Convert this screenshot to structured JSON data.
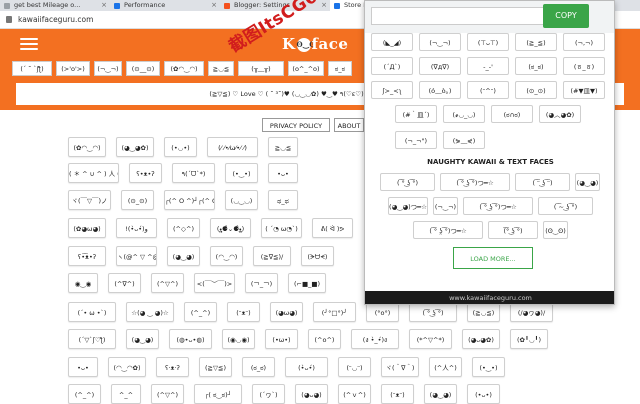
{
  "browser": {
    "tabs": [
      {
        "label": "get best Mileage o...",
        "icon": "page-icon"
      },
      {
        "label": "Performance",
        "icon": "page-icon"
      },
      {
        "label": "Blogger: Settings",
        "icon": "blogger-icon"
      },
      {
        "label": "Store L...",
        "icon": "store-icon"
      }
    ],
    "url": "kawaiifaceguru.com"
  },
  "site": {
    "logo_left": "K",
    "logo_face": "ʘ‿ʘ",
    "logo_right": "face",
    "banner_text": "(≧▽≦) ♡ Love ♡ ( ˘ ³˘)♥ (◡‿◡✿) ♥‿♥ ٩(♡ε♡)۶ (灬♥ω♥灬) ( ˘ ³˘)♥"
  },
  "watermark": "截图ItsCG6",
  "face_bar": [
    "(´ ˘ `ʃƪ)",
    "(>'o'>)",
    "(¬‿¬)",
    "(⊙__⊙)",
    "(✿◠‿◠)",
    "≧◡≦",
    "(╥﹏╥)",
    "(o^_^o)",
    "ಠ_ಠ",
    "ᕙ(⇀‸↼)ᕗ",
    "(◕‿◕✿)",
    "(ᵔᴥᵔ)",
    "<"
  ],
  "links": {
    "privacy": "PRIVACY POLICY",
    "about": "ABOUT"
  },
  "grid": [
    [
      "(✿◠‿◠)",
      "(◕‿◕✿)",
      "(•◡•)",
      "(⁄ ⁄•⁄ω⁄•⁄ ⁄)",
      "≧◡≦"
    ],
    [
      "( ＊ ^ ∪ ^ ) 人 (≧∀≦*)",
      "ʕ•ᴥ•ʔ",
      "٩(ˊᗜˋ*)",
      "(•‿•)",
      "•ᴗ•"
    ],
    [
      "ヾ(￣▽￣)ノ",
      "(⊙_⊙)",
      "┌(^ O ^)┘┌(^ O ^)┘",
      "(◡‿◡)",
      "ಥ_ಥ"
    ],
    [
      "(✿◕ω◕)",
      "!(•̀ᴗ•́)و",
      "(^◇^)",
      "(•ૢ⚈͒⌄⚈͒•ૢ)",
      "( ´◔ ω◔`)",
      "ᕕ( ᐛ )ᕗ"
    ],
    [
      "ʕ•͡ᴥ•ʔ",
      "ヽ(@^ ▽ ^@)ﾉ",
      "(◕‿◕)",
      "(◠‿◠)",
      "(≧∇≦)/",
      "(ᗒᗨᗕ)"
    ],
    [
      "◉‿◉",
      "(^∇^)",
      "(^▽^)",
      "<(￣︶￣)>",
      "(￢_￢)",
      "(⌐■_■)"
    ],
    [
      "(´• ω •`)",
      "☆(◕ ‿ ◕)☆",
      "(^_^)",
      "(ᵔᴥᵔ)",
      "(◕ω◕)",
      "(╯°□°)╯",
      "(°o°)",
      "( ͡° ͜ʖ ͡°)",
      "(≧◡≦)",
      "(/◕ヮ◕)/"
    ],
    [
      "(´▽`ʃ♡ƪ)",
      "(◕‿◕)",
      "(◍•ᴗ•◍)",
      "(◉◡◉)",
      "(•ω•)",
      "(^o^)",
      "(ง •̀_•́)ง",
      "(*^▽^*)",
      "(◕ᴗ◕✿)",
      "(✿╹◡╹)"
    ],
    [
      "•ᴗ•",
      "(◠‿◠✿)",
      "ʕ·ᴥ·ʔ",
      "(≧▽≦)",
      "(ಠ_ಠ)",
      "(•̀ᴗ•́)",
      "(ᵔ◡ᵔ)",
      "ヾ(＾∇＾)",
      "(^人^)",
      "(•‿•)"
    ],
    [
      "(^_^)",
      "^_^",
      "(^▽^)",
      "┌( ಠ‿ಠ)┘",
      "(´ヮ`)",
      "(◕ᴗ◕)",
      "(^ｖ^)",
      "(ᵔᴥᵔ)",
      "(◕‿◕)",
      "(•ᴗ•)"
    ]
  ],
  "popup": {
    "copy_label": "COPY",
    "clear_label": "X",
    "input_value": "",
    "rows": [
      [
        "(◣_◢)",
        "(¬‿¬)",
        "(⊤ᴗ⊤)",
        "(≧_≦)",
        "(¬,¬)"
      ],
      [
        "(´Д`)",
        "(∇д∇)",
        "-_-'",
        "(ಠ_ಠ)",
        "(ㆆ_ㆆ)"
      ],
      [
        "ʃ>_<ʅ",
        "(ó﹏ò｡)",
        "(ᵔ^ᵔ)",
        "(⊙_⊙)",
        "(#▼皿▼)"
      ],
      [
        "(#｀皿´)",
        "(҂◡_◡)",
        "(ಠ∩ಠ)",
        "(◕︿◕✿)"
      ],
      [
        "(¬_¬\")",
        "(⋟﹏⋞)"
      ]
    ],
    "section_title": "NAUGHTY KAWAII & TEXT FACES",
    "naughty_rows": [
      [
        "( ͡° ͜ʖ ͡°)",
        "( ͡° ͜ʖ ͡°)つ━☆",
        "( ͡ᵔ ͜ʖ ͡ᵔ)",
        "(◕‿◕)"
      ],
      [
        "(◕‿◕)つ━☆",
        "(¬‿¬)",
        "( ͡° ͜ʖ ͡°)つ━☆",
        "( ͡~ ͜ʖ ͡°)"
      ],
      [
        "( ͡° ʖ̯ ͡°)つ━☆",
        "(͡° ͜ʖ ͡°)",
        "(ʘ‿ʘ)"
      ]
    ],
    "load_more": "LOAD MORE...",
    "footer": "www.kawaiifaceguru.com"
  }
}
